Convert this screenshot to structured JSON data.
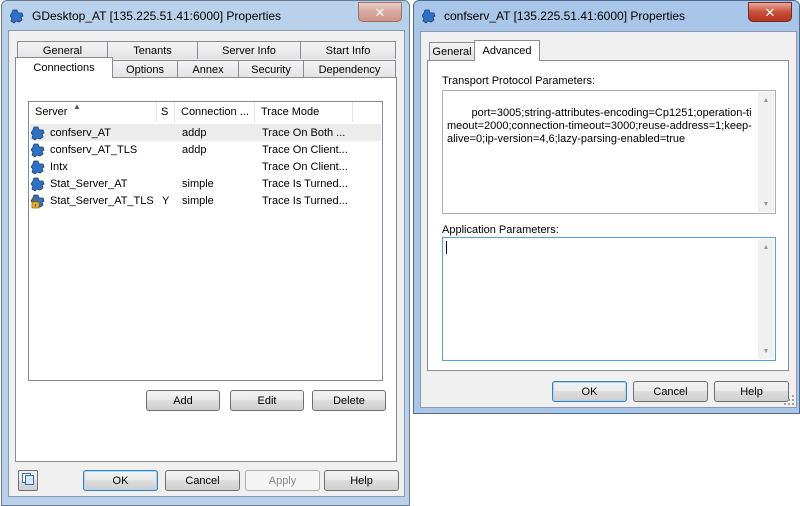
{
  "left_window": {
    "title": "GDesktop_AT [135.225.51.41:6000] Properties",
    "close_label": "✕",
    "tabs_row1": [
      "General",
      "Tenants",
      "Server Info",
      "Start Info"
    ],
    "tabs_row2": [
      "Connections",
      "Options",
      "Annex",
      "Security",
      "Dependency"
    ],
    "selected_tab": "Connections",
    "list": {
      "columns": [
        "Server",
        "S",
        "Connection ...",
        "Trace Mode"
      ],
      "sort_column": "Server",
      "rows": [
        {
          "icon": "server-icon",
          "server": "confserv_AT",
          "s": "",
          "connection": "addp",
          "trace": "Trace On Both ..."
        },
        {
          "icon": "server-icon",
          "server": "confserv_AT_TLS",
          "s": "",
          "connection": "addp",
          "trace": "Trace On Client..."
        },
        {
          "icon": "server-icon",
          "server": "Intx",
          "s": "",
          "connection": "",
          "trace": "Trace On Client..."
        },
        {
          "icon": "server-icon",
          "server": "Stat_Server_AT",
          "s": "",
          "connection": "simple",
          "trace": "Trace Is Turned..."
        },
        {
          "icon": "server-locked-icon",
          "server": "Stat_Server_AT_TLS",
          "s": "Y",
          "connection": "simple",
          "trace": "Trace Is Turned..."
        }
      ]
    },
    "list_buttons": {
      "add": "Add",
      "edit": "Edit",
      "delete": "Delete"
    },
    "footer_buttons": {
      "ok": "OK",
      "cancel": "Cancel",
      "apply": "Apply",
      "help": "Help"
    },
    "footer_icon": "copy-icon"
  },
  "right_window": {
    "title": "confserv_AT [135.225.51.41:6000] Properties",
    "close_label": "✕",
    "tabs": [
      "General",
      "Advanced"
    ],
    "selected_tab": "Advanced",
    "transport_label": "Transport Protocol Parameters:",
    "transport_value": "port=3005;string-attributes-encoding=Cp1251;operation-timeout=2000;connection-timeout=3000;reuse-address=1;keep-alive=0;ip-version=4,6;lazy-parsing-enabled=true",
    "application_label": "Application Parameters:",
    "application_value": "",
    "buttons": {
      "ok": "OK",
      "cancel": "Cancel",
      "help": "Help"
    }
  },
  "colors": {
    "accent": "#3c7fb1",
    "close_red": "#c9503a",
    "frame_active": "#a9c6e8",
    "frame_inactive": "#b9d1ea"
  }
}
